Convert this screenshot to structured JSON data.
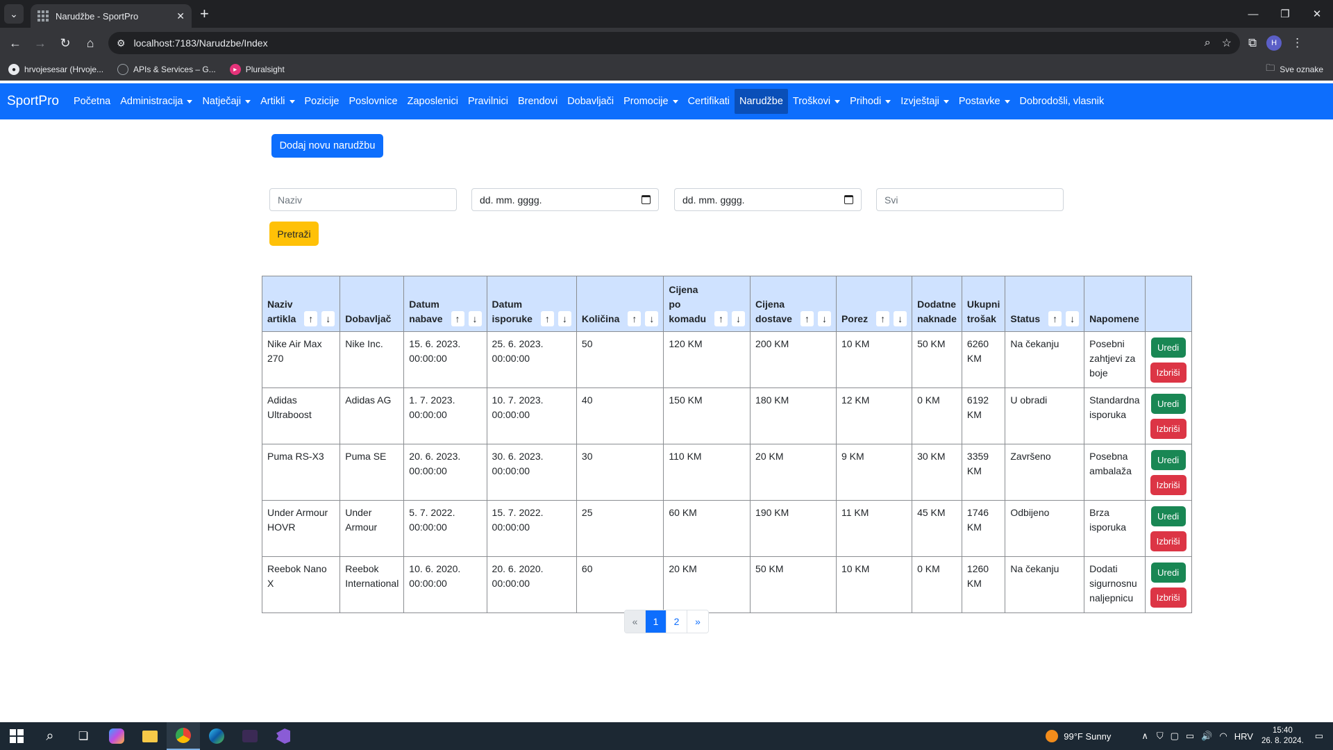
{
  "browser": {
    "tab_title": "Narudžbe - SportPro",
    "url": "localhost:7183/Narudzbe/Index",
    "bookmarks": [
      "hrvojesesar (Hrvoje...",
      "APIs & Services – G...",
      "Pluralsight"
    ],
    "bookmarks_right": "Sve oznake",
    "avatar_letter": "H"
  },
  "navbar": {
    "brand": "SportPro",
    "links": [
      {
        "label": "Početna",
        "dropdown": false
      },
      {
        "label": "Administracija",
        "dropdown": true
      },
      {
        "label": "Natječaji",
        "dropdown": true
      },
      {
        "label": "Artikli",
        "dropdown": true
      },
      {
        "label": "Pozicije",
        "dropdown": false
      },
      {
        "label": "Poslovnice",
        "dropdown": false
      },
      {
        "label": "Zaposlenici",
        "dropdown": false
      },
      {
        "label": "Pravilnici",
        "dropdown": false
      },
      {
        "label": "Brendovi",
        "dropdown": false
      },
      {
        "label": "Dobavljači",
        "dropdown": false
      },
      {
        "label": "Promocije",
        "dropdown": true
      },
      {
        "label": "Certifikati",
        "dropdown": false
      },
      {
        "label": "Narudžbe",
        "dropdown": false,
        "active": true
      },
      {
        "label": "Troškovi",
        "dropdown": true
      },
      {
        "label": "Prihodi",
        "dropdown": true
      },
      {
        "label": "Izvještaji",
        "dropdown": true
      },
      {
        "label": "Postavke",
        "dropdown": true
      },
      {
        "label": "Dobrodošli, vlasnik",
        "dropdown": false
      }
    ]
  },
  "page": {
    "add_button": "Dodaj novu narudžbu",
    "filters": {
      "name_placeholder": "Naziv",
      "date_from": "dd. mm. gggg.",
      "date_to": "dd. mm. gggg.",
      "status_placeholder": "Svi"
    },
    "search_button": "Pretraži"
  },
  "table": {
    "columns": [
      {
        "label": "Naziv artikla",
        "sortable": true
      },
      {
        "label": "Dobavljač",
        "sortable": false
      },
      {
        "label": "Datum nabave",
        "sortable": true
      },
      {
        "label": "Datum isporuke",
        "sortable": true
      },
      {
        "label": "Količina",
        "sortable": true
      },
      {
        "label": "Cijena po komadu",
        "sortable": true
      },
      {
        "label": "Cijena dostave",
        "sortable": true
      },
      {
        "label": "Porez",
        "sortable": true
      },
      {
        "label": "Dodatne naknade",
        "sortable": false
      },
      {
        "label": "Ukupni trošak",
        "sortable": false
      },
      {
        "label": "Status",
        "sortable": true
      },
      {
        "label": "Napomene",
        "sortable": false
      },
      {
        "label": "",
        "sortable": false
      }
    ],
    "sort_up": "↑",
    "sort_down": "↓",
    "rows": [
      {
        "naziv": "Nike Air Max 270",
        "dobavljac": "Nike Inc.",
        "nabava": "15. 6. 2023. 00:00:00",
        "isporuka": "25. 6. 2023. 00:00:00",
        "kolicina": "50",
        "cijena": "120 KM",
        "dostava": "200 KM",
        "porez": "10 KM",
        "naknade": "50 KM",
        "ukupno": "6260 KM",
        "status": "Na čekanju",
        "napomene": "Posebni zahtjevi za boje"
      },
      {
        "naziv": "Adidas Ultraboost",
        "dobavljac": "Adidas AG",
        "nabava": "1. 7. 2023. 00:00:00",
        "isporuka": "10. 7. 2023. 00:00:00",
        "kolicina": "40",
        "cijena": "150 KM",
        "dostava": "180 KM",
        "porez": "12 KM",
        "naknade": "0 KM",
        "ukupno": "6192 KM",
        "status": "U obradi",
        "napomene": "Standardna isporuka"
      },
      {
        "naziv": "Puma RS-X3",
        "dobavljac": "Puma SE",
        "nabava": "20. 6. 2023. 00:00:00",
        "isporuka": "30. 6. 2023. 00:00:00",
        "kolicina": "30",
        "cijena": "110 KM",
        "dostava": "20 KM",
        "porez": "9 KM",
        "naknade": "30 KM",
        "ukupno": "3359 KM",
        "status": "Završeno",
        "napomene": "Posebna ambalaža"
      },
      {
        "naziv": "Under Armour HOVR",
        "dobavljac": "Under Armour",
        "nabava": "5. 7. 2022. 00:00:00",
        "isporuka": "15. 7. 2022. 00:00:00",
        "kolicina": "25",
        "cijena": "60 KM",
        "dostava": "190 KM",
        "porez": "11 KM",
        "naknade": "45 KM",
        "ukupno": "1746 KM",
        "status": "Odbijeno",
        "napomene": "Brza isporuka"
      },
      {
        "naziv": "Reebok Nano X",
        "dobavljac": "Reebok International",
        "nabava": "10. 6. 2020. 00:00:00",
        "isporuka": "20. 6. 2020. 00:00:00",
        "kolicina": "60",
        "cijena": "20 KM",
        "dostava": "50 KM",
        "porez": "10 KM",
        "naknade": "0 KM",
        "ukupno": "1260 KM",
        "status": "Na čekanju",
        "napomene": "Dodati sigurnosnu naljepnicu"
      }
    ],
    "edit_label": "Uredi",
    "delete_label": "Izbriši"
  },
  "pagination": {
    "prev": "«",
    "pages": [
      "1",
      "2"
    ],
    "current": "1",
    "next": "»"
  },
  "taskbar": {
    "weather": "99°F  Sunny",
    "language": "HRV",
    "time": "15:40",
    "date": "26. 8. 2024."
  }
}
